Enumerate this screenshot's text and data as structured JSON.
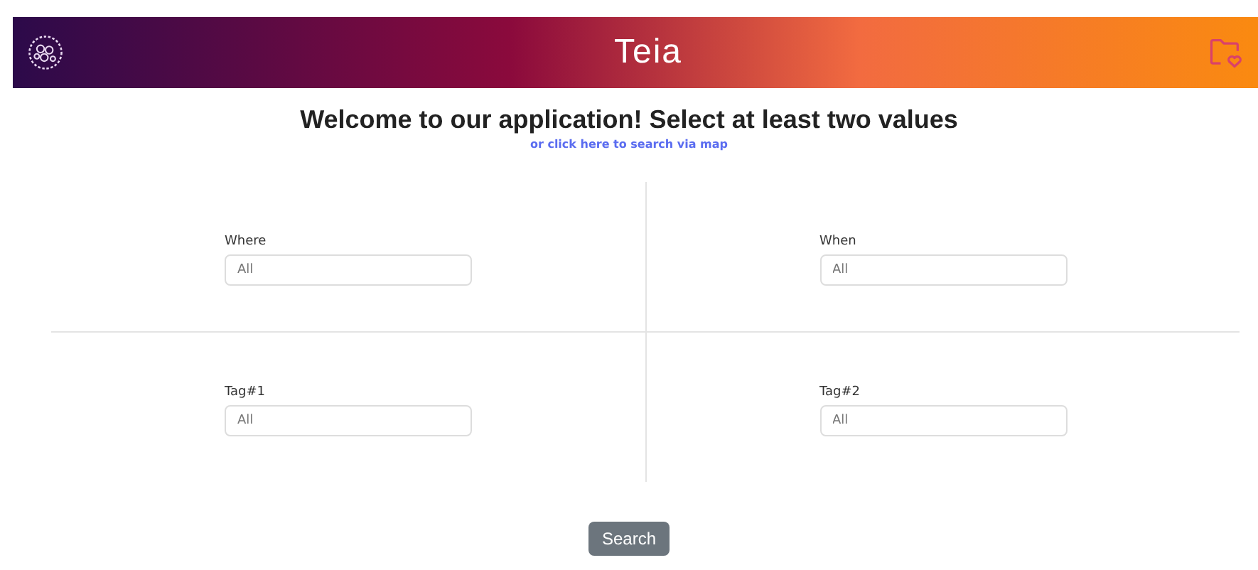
{
  "header": {
    "logo_text": "Teia"
  },
  "title": "Welcome to our application! Select at least two values",
  "map_link": "or click here to search via map",
  "filters": [
    {
      "label": "Where",
      "placeholder": "All"
    },
    {
      "label": "When",
      "placeholder": "All"
    },
    {
      "label": "Tag#1",
      "placeholder": "All"
    },
    {
      "label": "Tag#2",
      "placeholder": "All"
    }
  ],
  "search_button": "Search"
}
